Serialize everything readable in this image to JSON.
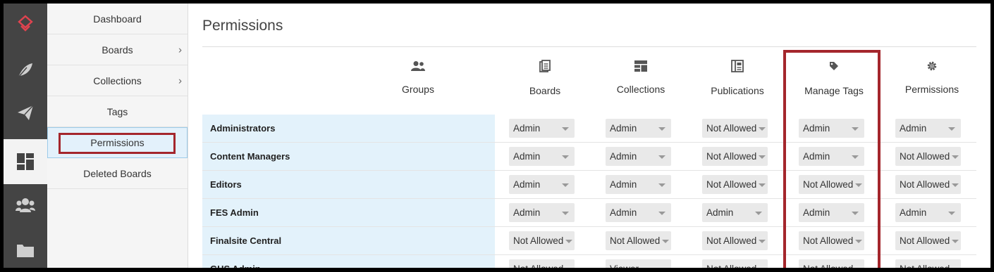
{
  "rail": {
    "items": [
      {
        "name": "logo-icon"
      },
      {
        "name": "feather-icon"
      },
      {
        "name": "paper-plane-icon"
      },
      {
        "name": "dashboard-icon",
        "active": true
      },
      {
        "name": "users-icon"
      },
      {
        "name": "folder-icon"
      }
    ]
  },
  "subnav": {
    "items": [
      {
        "label": "Dashboard",
        "chevron": false
      },
      {
        "label": "Boards",
        "chevron": true
      },
      {
        "label": "Collections",
        "chevron": true
      },
      {
        "label": "Tags",
        "chevron": false
      },
      {
        "label": "Permissions",
        "chevron": false,
        "active": true
      },
      {
        "label": "Deleted Boards",
        "chevron": false
      }
    ]
  },
  "page": {
    "title": "Permissions"
  },
  "columns": {
    "groups": "Groups",
    "boards": "Boards",
    "collections": "Collections",
    "publications": "Publications",
    "manage_tags": "Manage Tags",
    "permissions": "Permissions"
  },
  "rows": [
    {
      "group": "Administrators",
      "values": [
        "Admin",
        "Admin",
        "Not Allowed",
        "Admin",
        "Admin"
      ]
    },
    {
      "group": "Content Managers",
      "values": [
        "Admin",
        "Admin",
        "Not Allowed",
        "Admin",
        "Not Allowed"
      ]
    },
    {
      "group": "Editors",
      "values": [
        "Admin",
        "Admin",
        "Not Allowed",
        "Not Allowed",
        "Not Allowed"
      ]
    },
    {
      "group": "FES Admin",
      "values": [
        "Admin",
        "Admin",
        "Admin",
        "Admin",
        "Admin"
      ]
    },
    {
      "group": "Finalsite Central",
      "values": [
        "Not Allowed",
        "Not Allowed",
        "Not Allowed",
        "Not Allowed",
        "Not Allowed"
      ]
    },
    {
      "group": "GHS Admin",
      "values": [
        "Not Allowed",
        "Viewer",
        "Not Allowed",
        "Not Allowed",
        "Not Allowed"
      ]
    }
  ],
  "colors": {
    "highlight": "#a4262c",
    "rail_bg": "#444444",
    "group_cell_bg": "#e3f2fb",
    "logo_accent": "#e0434f"
  }
}
